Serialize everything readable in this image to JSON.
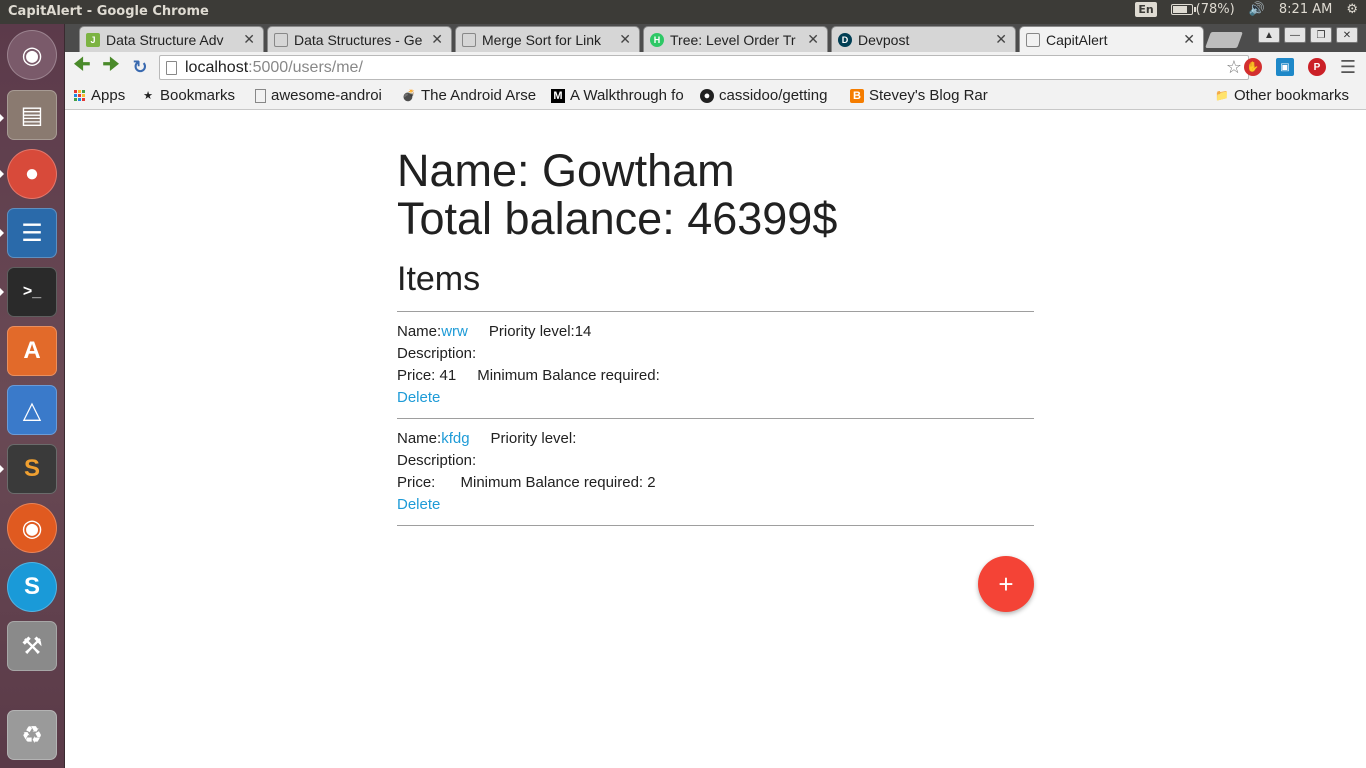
{
  "window": {
    "title": "CapitAlert - Google Chrome"
  },
  "top_panel": {
    "keyboard": "En",
    "battery": "(78%)",
    "battery_level": 0.78,
    "time": "8:21 AM"
  },
  "tabs": [
    {
      "label": "Data Structure Adv",
      "favicon_color": "#7cb342",
      "favicon_text": "J"
    },
    {
      "label": "Data Structures - Ge",
      "favicon_color": "#ffffff",
      "favicon_text": ""
    },
    {
      "label": "Merge Sort for Link",
      "favicon_color": "#ffffff",
      "favicon_text": ""
    },
    {
      "label": "Tree: Level Order Tr",
      "favicon_color": "#2ec866",
      "favicon_text": "H"
    },
    {
      "label": "Devpost",
      "favicon_color": "#003e54",
      "favicon_text": "D"
    },
    {
      "label": "CapitAlert",
      "favicon_color": "#ffffff",
      "favicon_text": ""
    }
  ],
  "address_bar": {
    "host": "localhost",
    "path": ":5000/users/me/"
  },
  "bookmarks": [
    {
      "label": "Apps",
      "icon": "apps-grid-icon"
    },
    {
      "label": "Bookmarks",
      "icon": "star-icon"
    },
    {
      "label": "awesome-androi",
      "icon": "page-icon"
    },
    {
      "label": "The Android Arse",
      "icon": "bomb-icon"
    },
    {
      "label": "A Walkthrough fo",
      "icon": "medium-icon"
    },
    {
      "label": "cassidoo/getting",
      "icon": "github-icon"
    },
    {
      "label": "Stevey's Blog Rar",
      "icon": "blogger-icon"
    },
    {
      "label": "Other bookmarks",
      "icon": "folder-icon"
    }
  ],
  "user": {
    "name": "Name: Gowtham",
    "balance": "Total balance: 46399$"
  },
  "items_heading": "Items",
  "items": [
    {
      "name_label": "Name:",
      "name": "wrw",
      "priority_label": "Priority level:",
      "priority": "14",
      "description_label": "Description:",
      "description": "",
      "price_label": "Price:",
      "price": "41",
      "min_balance_label": "Minimum Balance required:",
      "min_balance": "",
      "delete_label": "Delete"
    },
    {
      "name_label": "Name:",
      "name": "kfdg",
      "priority_label": "Priority level:",
      "priority": "",
      "description_label": "Description:",
      "description": "",
      "price_label": "Price:",
      "price": "",
      "min_balance_label": "Minimum Balance required:",
      "min_balance": "2",
      "delete_label": "Delete"
    }
  ],
  "fab_label": "+",
  "colors": {
    "link": "#1e9bd7",
    "fab": "#f44336"
  }
}
